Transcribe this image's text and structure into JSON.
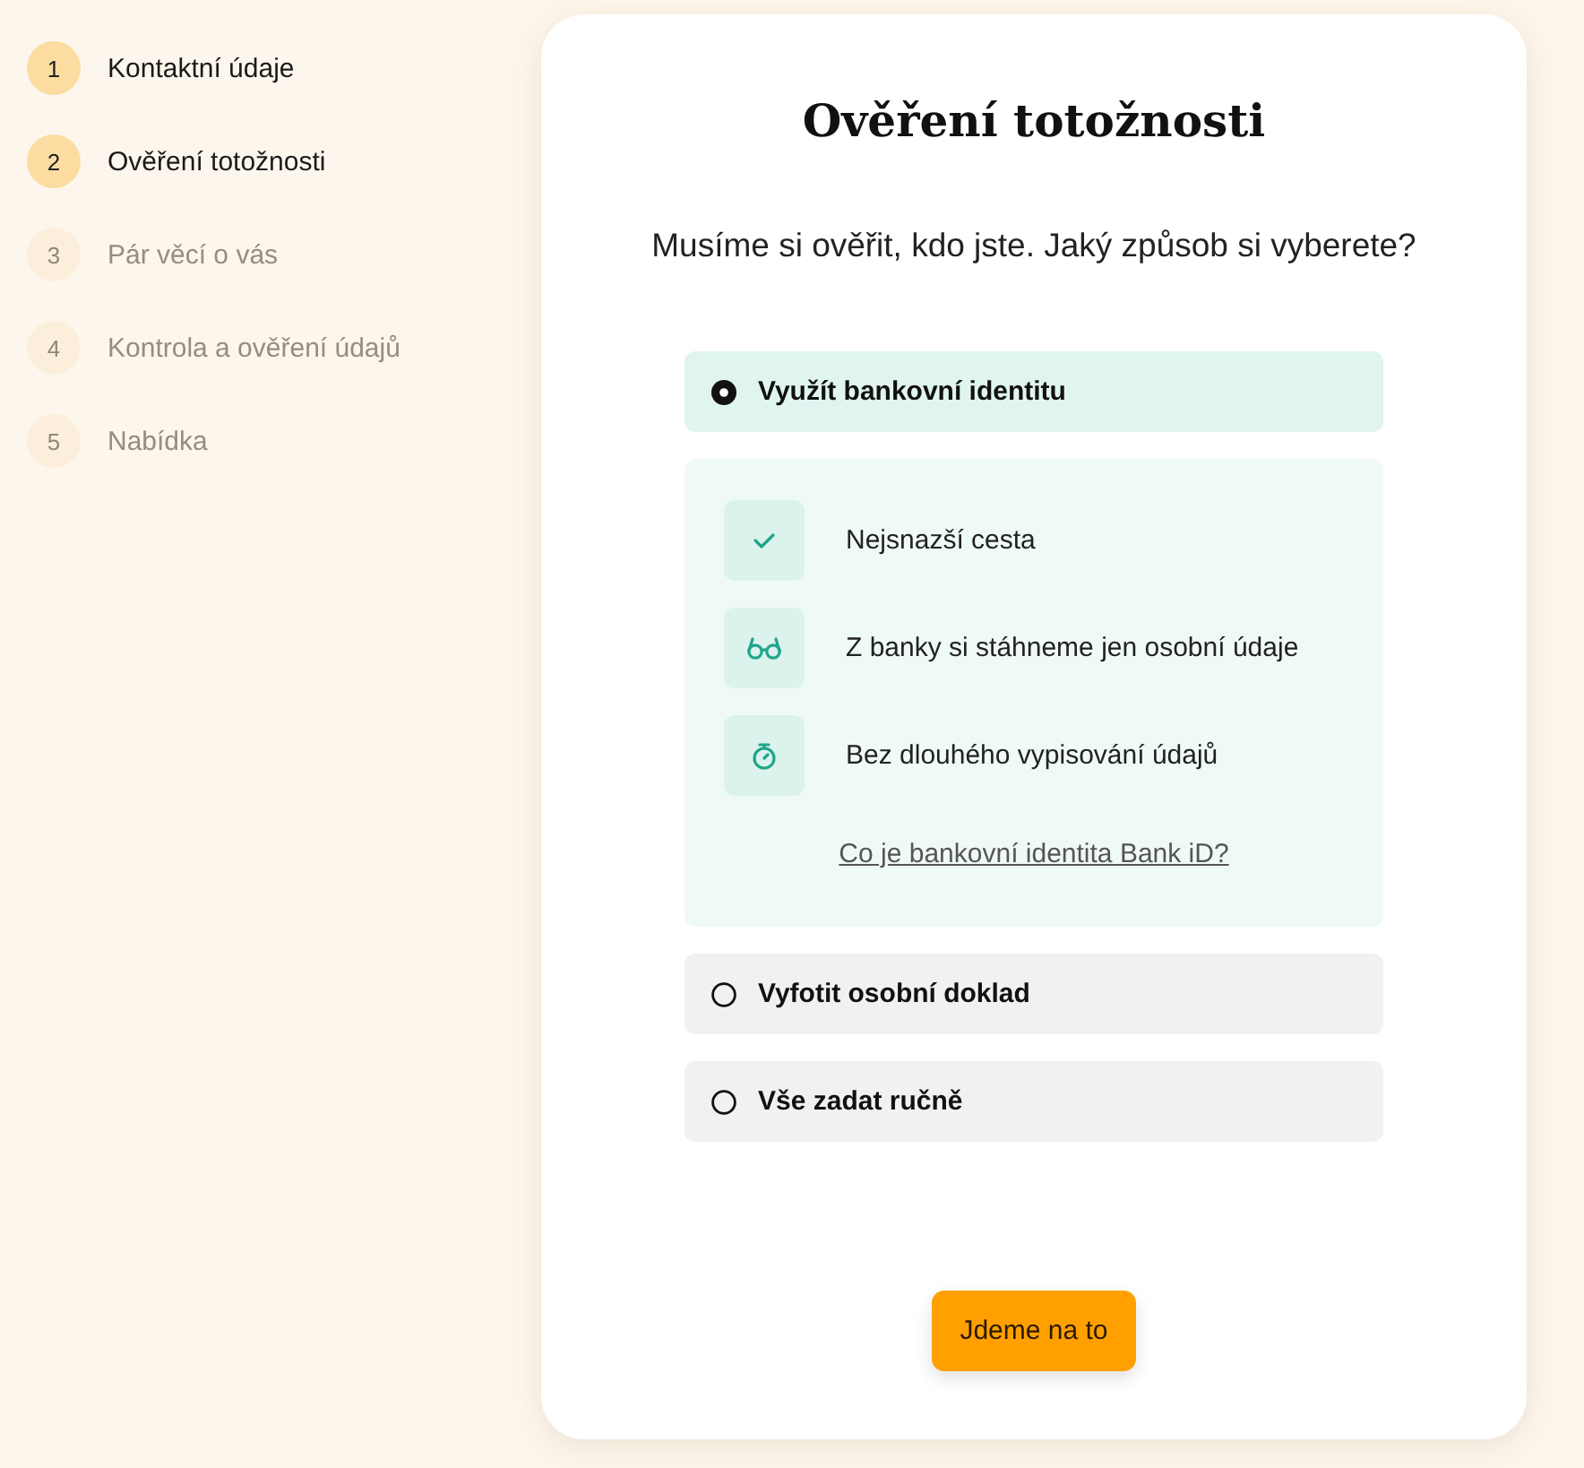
{
  "steps": [
    {
      "number": "1",
      "label": "Kontaktní údaje",
      "disabled": false
    },
    {
      "number": "2",
      "label": "Ověření totožnosti",
      "disabled": false
    },
    {
      "number": "3",
      "label": "Pár věcí o vás",
      "disabled": true
    },
    {
      "number": "4",
      "label": "Kontrola a ověření údajů",
      "disabled": true
    },
    {
      "number": "5",
      "label": "Nabídka",
      "disabled": true
    }
  ],
  "card": {
    "title": "Ověření totožnosti",
    "subtitle": "Musíme si ověřit, kdo jste. Jaký způsob si vyberete?"
  },
  "options": [
    {
      "label": "Využít bankovní identitu",
      "selected": true,
      "details": {
        "features": [
          {
            "kind": "check",
            "text": "Nejsnazší cesta"
          },
          {
            "kind": "glasses",
            "text": "Z banky si stáhneme jen osobní údaje"
          },
          {
            "kind": "stopwatch",
            "text": "Bez dlouhého vypisování údajů"
          }
        ],
        "link": "Co je bankovní identita Bank iD?"
      }
    },
    {
      "label": "Vyfotit osobní doklad",
      "selected": false
    },
    {
      "label": "Vše zadat ručně",
      "selected": false
    }
  ],
  "button": {
    "label": "Jdeme na to"
  }
}
